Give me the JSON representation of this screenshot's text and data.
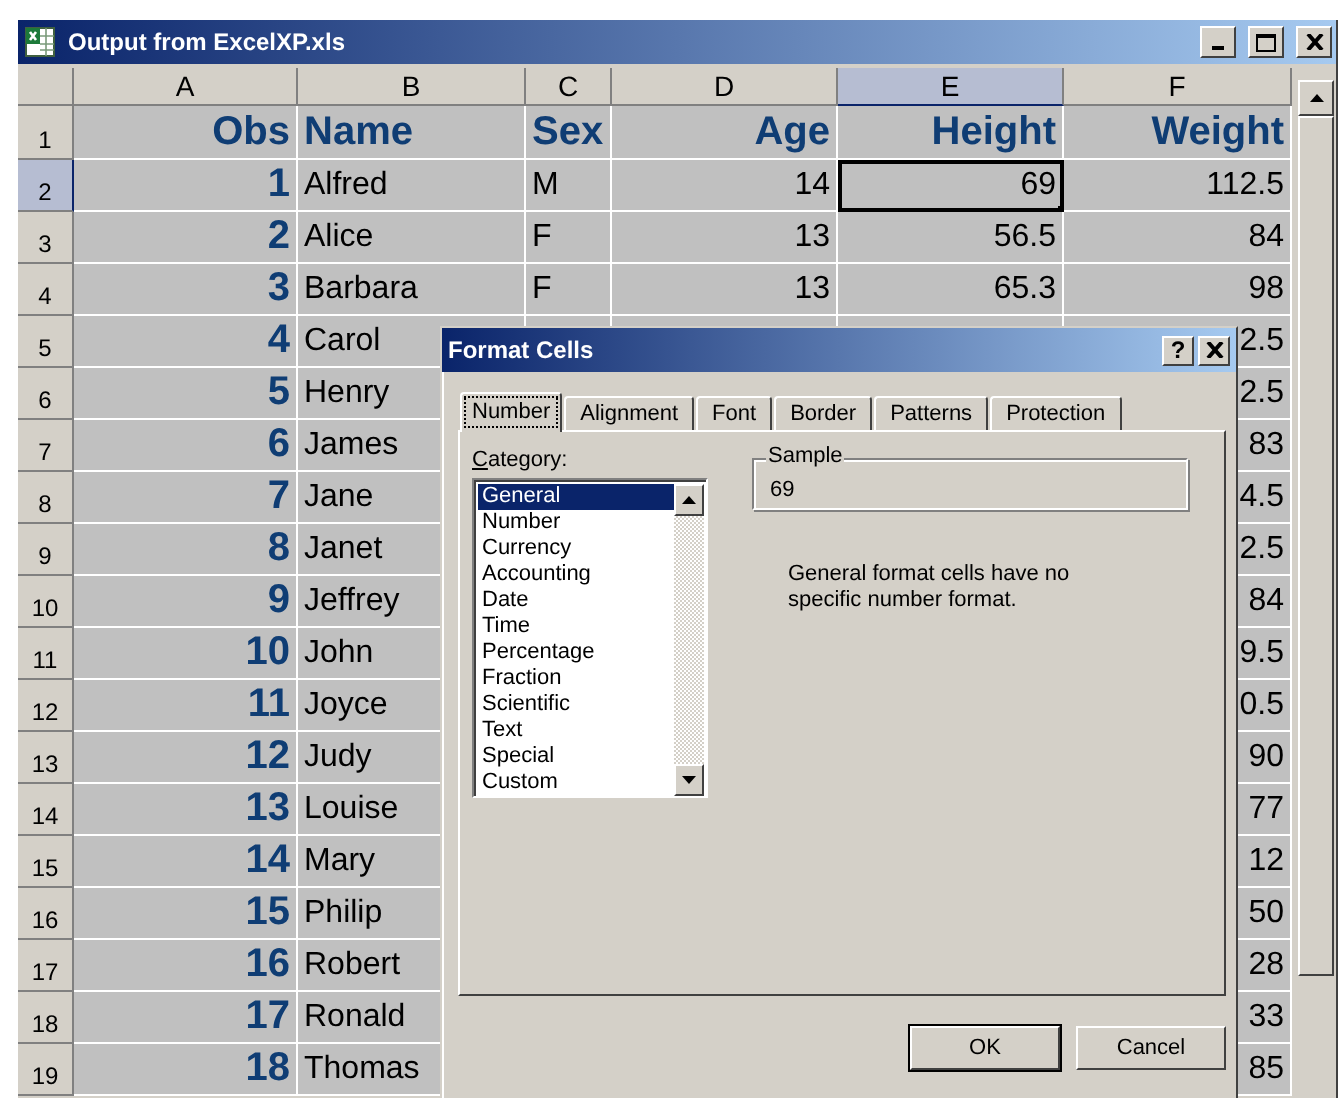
{
  "window": {
    "title": "Output from ExcelXP.xls"
  },
  "columns": [
    {
      "label": "A",
      "selected": false
    },
    {
      "label": "B",
      "selected": false
    },
    {
      "label": "C",
      "selected": false
    },
    {
      "label": "D",
      "selected": false
    },
    {
      "label": "E",
      "selected": true
    },
    {
      "label": "F",
      "selected": false
    }
  ],
  "rows": [
    {
      "number": "1",
      "selected": false,
      "kind": "header",
      "cells": {
        "A": "Obs",
        "B": "Name",
        "C": "Sex",
        "D": "Age",
        "E": "Height",
        "F": "Weight"
      }
    },
    {
      "number": "2",
      "selected": true,
      "kind": "data",
      "cells": {
        "A": "1",
        "B": "Alfred",
        "C": "M",
        "D": "14",
        "E": "69",
        "F": "112.5"
      }
    },
    {
      "number": "3",
      "selected": false,
      "kind": "data",
      "cells": {
        "A": "2",
        "B": "Alice",
        "C": "F",
        "D": "13",
        "E": "56.5",
        "F": "84"
      }
    },
    {
      "number": "4",
      "selected": false,
      "kind": "data",
      "cells": {
        "A": "3",
        "B": "Barbara",
        "C": "F",
        "D": "13",
        "E": "65.3",
        "F": "98"
      }
    },
    {
      "number": "5",
      "selected": false,
      "kind": "data",
      "cells": {
        "A": "4",
        "B": "Carol",
        "F": "2.5"
      }
    },
    {
      "number": "6",
      "selected": false,
      "kind": "data",
      "cells": {
        "A": "5",
        "B": "Henry",
        "F": "2.5"
      }
    },
    {
      "number": "7",
      "selected": false,
      "kind": "data",
      "cells": {
        "A": "6",
        "B": "James",
        "F": "83"
      }
    },
    {
      "number": "8",
      "selected": false,
      "kind": "data",
      "cells": {
        "A": "7",
        "B": "Jane",
        "F": "4.5"
      }
    },
    {
      "number": "9",
      "selected": false,
      "kind": "data",
      "cells": {
        "A": "8",
        "B": "Janet",
        "F": "2.5"
      }
    },
    {
      "number": "10",
      "selected": false,
      "kind": "data",
      "cells": {
        "A": "9",
        "B": "Jeffrey",
        "F": "84"
      }
    },
    {
      "number": "11",
      "selected": false,
      "kind": "data",
      "cells": {
        "A": "10",
        "B": "John",
        "F": "9.5"
      }
    },
    {
      "number": "12",
      "selected": false,
      "kind": "data",
      "cells": {
        "A": "11",
        "B": "Joyce",
        "F": "0.5"
      }
    },
    {
      "number": "13",
      "selected": false,
      "kind": "data",
      "cells": {
        "A": "12",
        "B": "Judy",
        "F": "90"
      }
    },
    {
      "number": "14",
      "selected": false,
      "kind": "data",
      "cells": {
        "A": "13",
        "B": "Louise",
        "F": "77"
      }
    },
    {
      "number": "15",
      "selected": false,
      "kind": "data",
      "cells": {
        "A": "14",
        "B": "Mary",
        "F": "12"
      }
    },
    {
      "number": "16",
      "selected": false,
      "kind": "data",
      "cells": {
        "A": "15",
        "B": "Philip",
        "F": "50"
      }
    },
    {
      "number": "17",
      "selected": false,
      "kind": "data",
      "cells": {
        "A": "16",
        "B": "Robert",
        "F": "28"
      }
    },
    {
      "number": "18",
      "selected": false,
      "kind": "data",
      "cells": {
        "A": "17",
        "B": "Ronald",
        "F": "33"
      }
    },
    {
      "number": "19",
      "selected": false,
      "kind": "data",
      "cells": {
        "A": "18",
        "B": "Thomas",
        "F": "85"
      }
    }
  ],
  "dialog": {
    "title": "Format Cells",
    "help": "?",
    "tabs": [
      {
        "label": "Number",
        "selected": true
      },
      {
        "label": "Alignment",
        "selected": false
      },
      {
        "label": "Font",
        "selected": false
      },
      {
        "label": "Border",
        "selected": false
      },
      {
        "label": "Patterns",
        "selected": false
      },
      {
        "label": "Protection",
        "selected": false
      }
    ],
    "category_label": "Category:",
    "categories": [
      {
        "label": "General",
        "selected": true
      },
      {
        "label": "Number",
        "selected": false
      },
      {
        "label": "Currency",
        "selected": false
      },
      {
        "label": "Accounting",
        "selected": false
      },
      {
        "label": "Date",
        "selected": false
      },
      {
        "label": "Time",
        "selected": false
      },
      {
        "label": "Percentage",
        "selected": false
      },
      {
        "label": "Fraction",
        "selected": false
      },
      {
        "label": "Scientific",
        "selected": false
      },
      {
        "label": "Text",
        "selected": false
      },
      {
        "label": "Special",
        "selected": false
      },
      {
        "label": "Custom",
        "selected": false
      }
    ],
    "sample": {
      "label": "Sample",
      "value": "69"
    },
    "description": "General format cells have no specific number format.",
    "buttons": [
      "OK",
      "Cancel"
    ]
  }
}
